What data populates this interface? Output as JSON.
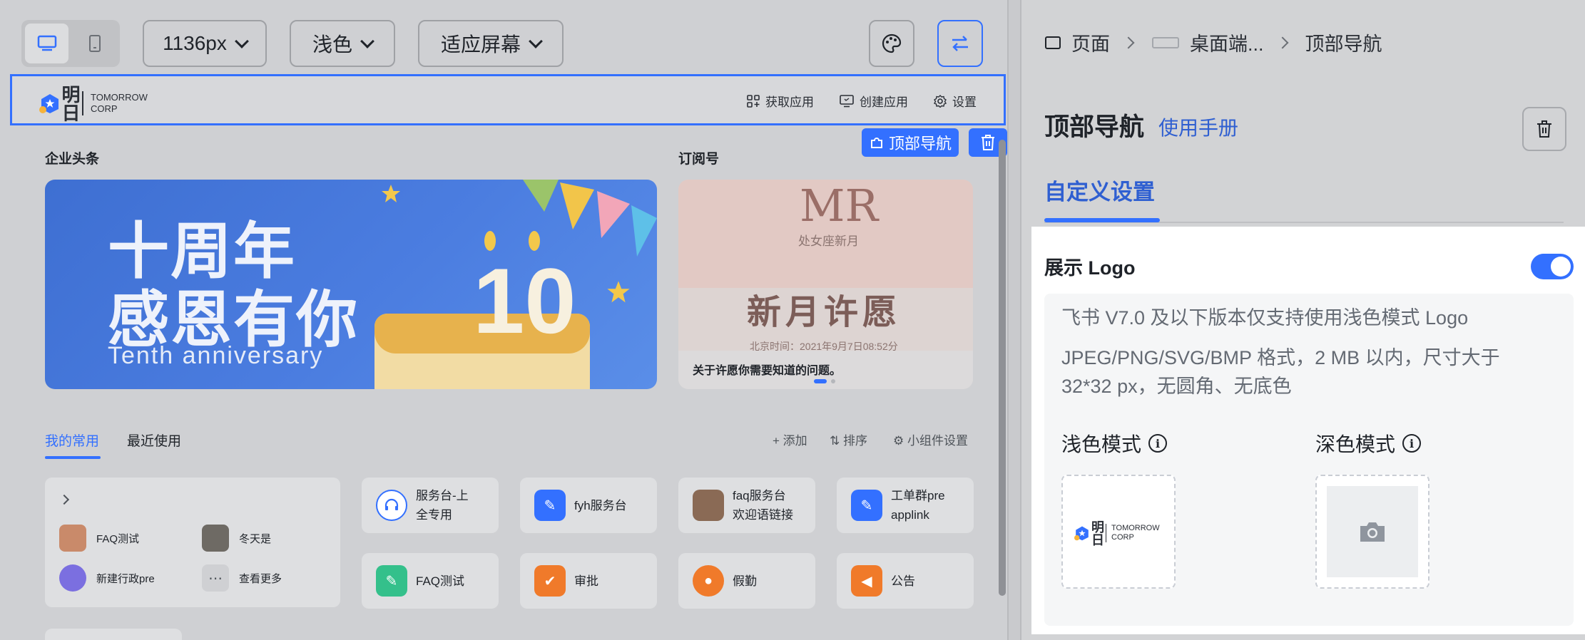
{
  "toolbar": {
    "width_select": "1136px",
    "theme_select": "浅色",
    "fit_select": "适应屏幕"
  },
  "nav_preview": {
    "logo_cn": "明日",
    "logo_en_1": "TOMORROW",
    "logo_en_2": "CORP",
    "links": [
      "获取应用",
      "创建应用",
      "设置"
    ]
  },
  "component_tag": "顶部导航",
  "sections": {
    "headline": "企业头条",
    "subscription": "订阅号"
  },
  "banner_main": {
    "line1": "十周年",
    "line2": "感恩有你",
    "line3": "Tenth anniversary",
    "number": "10"
  },
  "banner_sub": {
    "mark": "MR",
    "small": "处女座新月",
    "title": "新月许愿",
    "date": "北京时间：2021年9月7日08:52分",
    "caption": "关于许愿你需要知道的问题。"
  },
  "tabs": [
    "我的常用",
    "最近使用"
  ],
  "ops": [
    "+ 添加",
    "⇅ 排序",
    "⚙ 小组件设置"
  ],
  "favorites": [
    "FAQ测试",
    "冬天是",
    "新建行政pre",
    "查看更多"
  ],
  "apps": [
    {
      "label1": "服务台-上",
      "label2": "全专用",
      "icon_color": "#ffffff"
    },
    {
      "label1": "fyh服务台",
      "label2": "",
      "icon_color": "#3370ff"
    },
    {
      "label1": "faq服务台",
      "label2": "欢迎语链接",
      "icon_color": "#8a6a55"
    },
    {
      "label1": "工单群pre",
      "label2": "applink",
      "icon_color": "#3370ff"
    },
    {
      "label1": "FAQ测试",
      "label2": "",
      "icon_color": "#34c08b"
    },
    {
      "label1": "审批",
      "label2": "",
      "icon_color": "#f07a2a"
    },
    {
      "label1": "假勤",
      "label2": "",
      "icon_color": "#f07a2a"
    },
    {
      "label1": "公告",
      "label2": "",
      "icon_color": "#f07a2a"
    }
  ],
  "breadcrumb": [
    "页面",
    "桌面端...",
    "顶部导航"
  ],
  "panel": {
    "title": "顶部导航",
    "manual": "使用手册",
    "tab": "自定义设置",
    "logo_label": "展示 Logo",
    "logo_enabled": true,
    "info_1": "飞书 V7.0 及以下版本仅支持使用浅色模式 Logo",
    "info_2": "JPEG/PNG/SVG/BMP 格式，2 MB 以内，尺寸大于",
    "info_3": "32*32 px，无圆角、无底色",
    "light_mode": "浅色模式",
    "dark_mode": "深色模式"
  },
  "colors": {
    "accent": "#3370ff"
  }
}
